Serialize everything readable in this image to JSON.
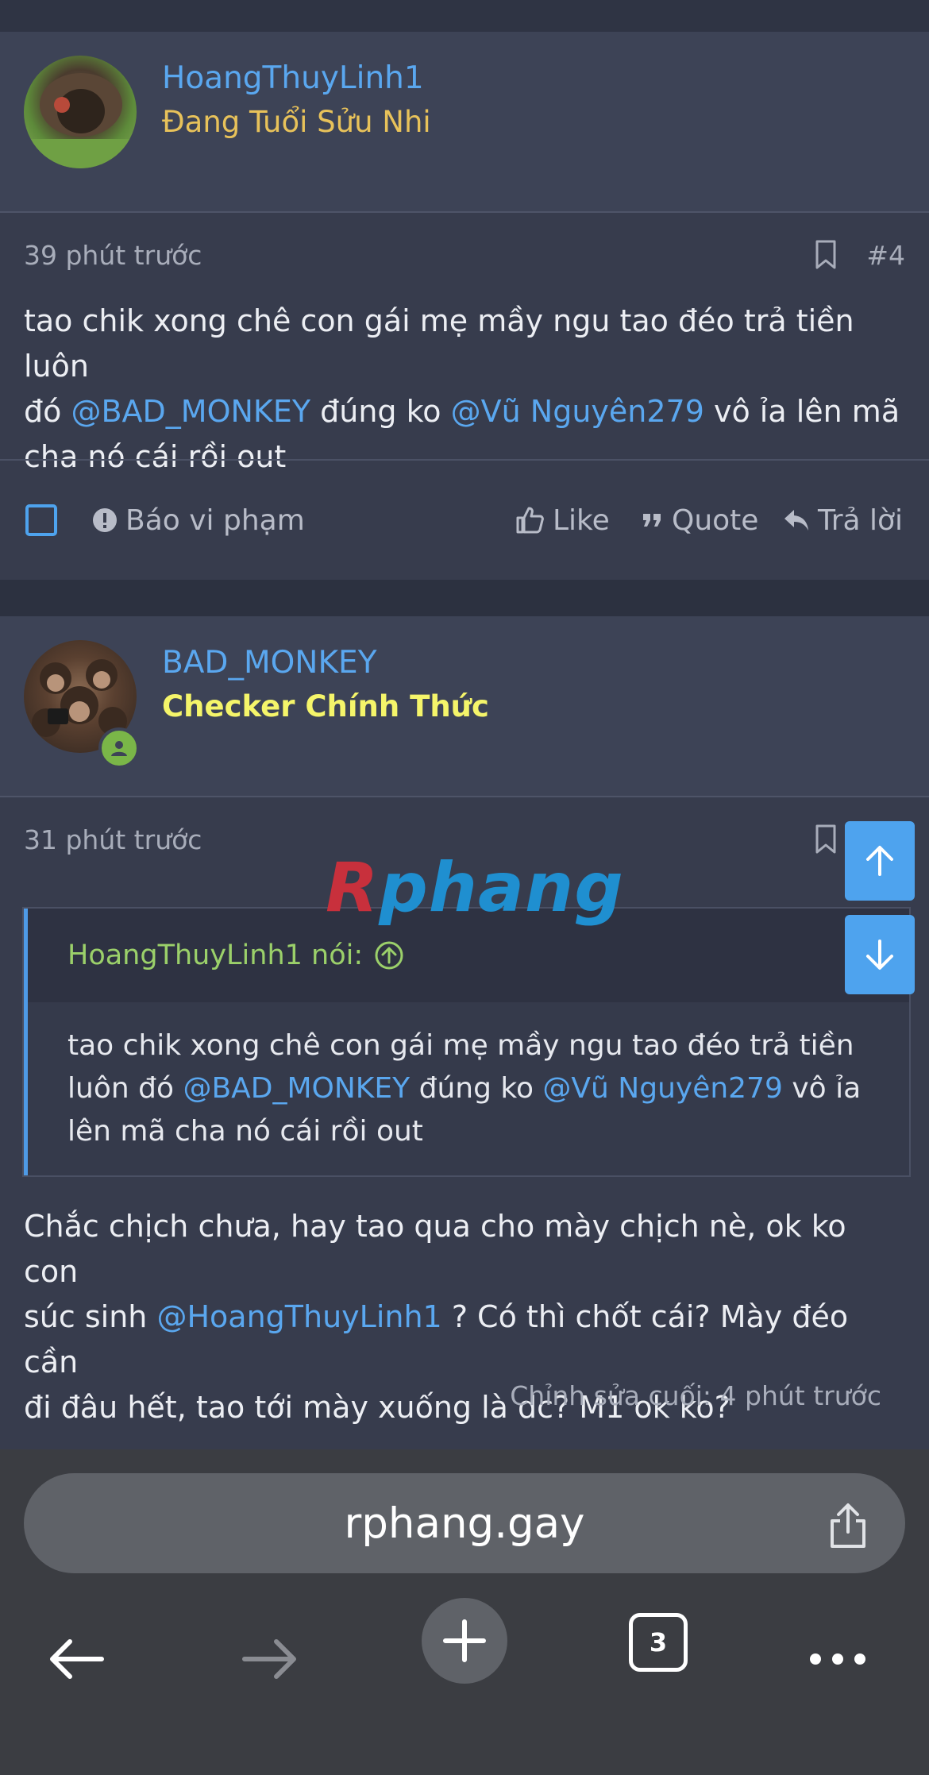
{
  "posts": [
    {
      "username": "HoangThuyLinh1",
      "user_title": "Đang Tuổi Sửu Nhi",
      "user_title_color": "#e8c25a",
      "time": "39 phút trước",
      "number": "#4",
      "content": {
        "p1": "tao chik xong chê con gái mẹ mầy ngu tao đéo trả tiền luôn",
        "p2_pre": "đó ",
        "mention1": "@BAD_MONKEY",
        "p2_mid": " đúng ko ",
        "mention2": "@Vũ Nguyên279",
        "p2_post": " vô ỉa lên mã",
        "p3": "cha nó cái rồi out"
      },
      "actions": {
        "report": "Báo vi phạm",
        "like": "Like",
        "quote": "Quote",
        "reply": "Trả lời"
      }
    },
    {
      "username": "BAD_MONKEY",
      "user_title": "Checker Chính Thức",
      "user_title_color": "#f5f56a",
      "time": "31 phút trước",
      "quote": {
        "author": "HoangThuyLinh1 nói:",
        "l1": "tao chik xong chê con gái mẹ mầy ngu tao đéo trả tiền",
        "l2_pre": "luôn đó ",
        "mention1": "@BAD_MONKEY",
        "l2_mid": " đúng ko ",
        "mention2": "@Vũ Nguyên279",
        "l2_post": " vô ỉa",
        "l3": "lên mã cha nó cái rồi out"
      },
      "content": {
        "p1": "Chắc chịch chưa, hay tao qua cho mày chịch nè, ok ko con",
        "p2_pre": "súc sinh ",
        "mention": "@HoangThuyLinh1",
        "p2_post": " ? Có thì chốt cái? Mày đéo cần",
        "p3": "đi đâu hết, tao tới mày xuống là dc? M1 ok ko?"
      },
      "edited": "Chỉnh sửa cuối: 4 phút trước"
    }
  ],
  "watermark": {
    "text": "Rphang",
    "first": "R",
    "rest": "phang"
  },
  "browser": {
    "url": "rphang.gay",
    "tab_count": "3"
  },
  "colors": {
    "link": "#5aa7ef",
    "accent": "#4ea3ee",
    "online": "#7ab648"
  }
}
